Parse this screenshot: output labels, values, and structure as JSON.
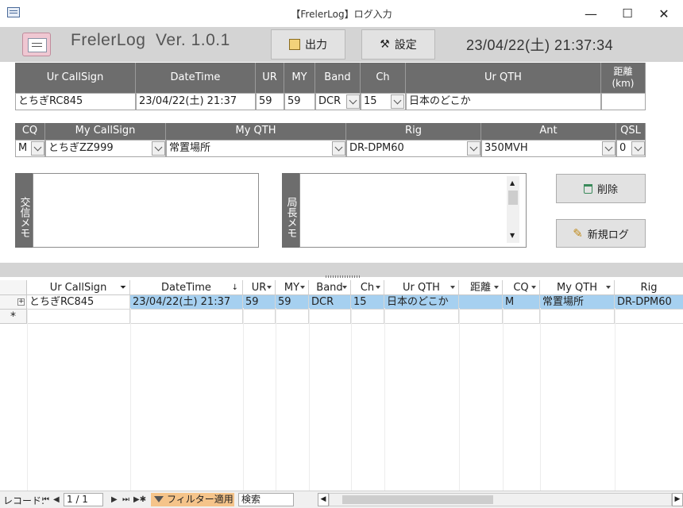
{
  "window": {
    "title": "【FrelerLog】ログ入力",
    "minimize": "—",
    "maximize": "☐",
    "close": "✕"
  },
  "header": {
    "app_name": "FrelerLog  Ver. 1.0.1",
    "output_button": "出力",
    "settings_button": "設定",
    "clock": "23/04/22(土) 21:37:34"
  },
  "qso_form": {
    "headers": [
      "Ur CallSign",
      "DateTime",
      "UR",
      "MY",
      "Band",
      "Ch",
      "Ur QTH",
      "距離\n(km)"
    ],
    "values": {
      "ur_callsign": "とちぎRC845",
      "datetime": "23/04/22(土) 21:37",
      "ur": "59",
      "my": "59",
      "band": "DCR",
      "ch": "15",
      "ur_qth": "日本のどこか",
      "distance": ""
    }
  },
  "station_form": {
    "headers": [
      "CQ",
      "My CallSign",
      "My QTH",
      "Rig",
      "Ant",
      "QSL"
    ],
    "values": {
      "cq": "M",
      "my_callsign": "とちぎZZ999",
      "my_qth": "常置場所",
      "rig": "DR-DPM60",
      "ant": "350MVH",
      "qsl": "0"
    }
  },
  "memos": {
    "exchange_label": "交信メモ",
    "exchange_value": "",
    "station_label": "局長メモ",
    "station_value": ""
  },
  "actions": {
    "delete_button": "削除",
    "new_log_button": "新規ログ"
  },
  "datasheet": {
    "columns": [
      "Ur CallSign",
      "DateTime",
      "UR",
      "MY",
      "Band",
      "Ch",
      "Ur QTH",
      "距離",
      "CQ",
      "My QTH",
      "Rig"
    ],
    "rows": [
      [
        "とちぎRC845",
        "23/04/22(土) 21:37",
        "59",
        "59",
        "DCR",
        "15",
        "日本のどこか",
        "",
        "M",
        "常置場所",
        "DR-DPM60"
      ]
    ],
    "new_row_marker": "*"
  },
  "status_bar": {
    "record_label": "レコード:",
    "record_position": "1 / 1",
    "filter_label": "フィルター適用",
    "search_placeholder": "検索"
  },
  "colors": {
    "header_band": "#d4d4d4",
    "label_dark": "#6d6d6d",
    "selected_row": "#a6d0f0",
    "filter_badge": "#f5c48a"
  }
}
